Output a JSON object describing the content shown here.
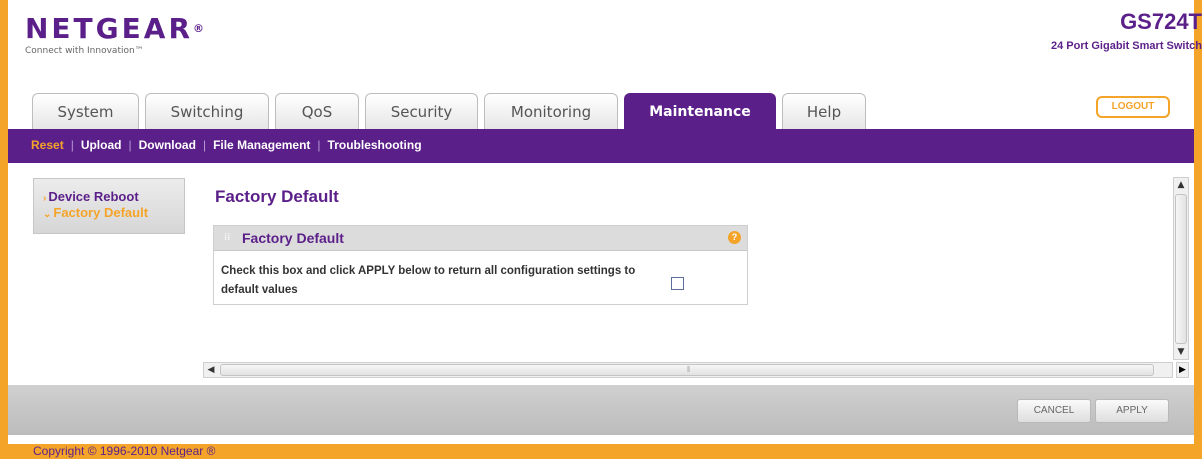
{
  "header": {
    "brand": "NETGEAR",
    "brand_mark": "®",
    "tagline": "Connect with Innovation™",
    "model": "GS724T",
    "model_desc": "24 Port Gigabit Smart Switch",
    "logout_label": "LOGOUT"
  },
  "tabs": [
    {
      "label": "System"
    },
    {
      "label": "Switching"
    },
    {
      "label": "QoS"
    },
    {
      "label": "Security"
    },
    {
      "label": "Monitoring"
    },
    {
      "label": "Maintenance"
    },
    {
      "label": "Help"
    }
  ],
  "subnav": [
    "Reset",
    "Upload",
    "Download",
    "File Management",
    "Troubleshooting"
  ],
  "leftmenu": {
    "item1": "Device Reboot",
    "item2": "Factory Default"
  },
  "page_title": "Factory Default",
  "panel": {
    "title": "Factory Default",
    "help_icon": "?",
    "description": "Check this box and click APPLY below to return all configuration settings to default values"
  },
  "buttons": {
    "cancel": "CANCEL",
    "apply": "APPLY"
  },
  "footer": "Copyright © 1996-2010 Netgear ®",
  "colors": {
    "brand_purple": "#5b1f8a",
    "accent_orange": "#f4a429"
  }
}
